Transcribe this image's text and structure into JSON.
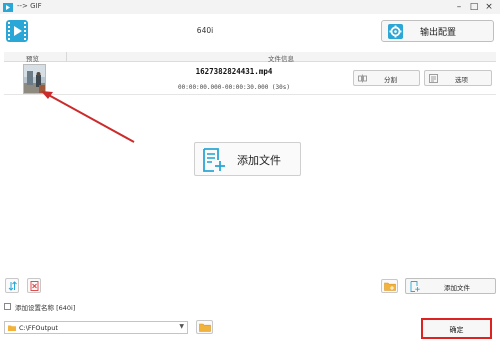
{
  "window": {
    "title": "--> GIF",
    "controls": [
      "minimize",
      "maximize",
      "close"
    ]
  },
  "toolbar": {
    "preset_name": "640i",
    "output_config_label": "输出配置"
  },
  "table": {
    "columns": [
      "预览",
      "文件信息"
    ],
    "rows": [
      {
        "filename": "1627382824431.mp4",
        "time_range": "00:00:00.000-00:00:30.000 (30s)",
        "split_label": "分割",
        "options_label": "选项"
      }
    ]
  },
  "empty_area": {
    "add_file_label": "添加文件"
  },
  "bottom": {
    "add_file_label": "添加文件",
    "add_preset_name_label": "添加设置名称 [640i]",
    "add_preset_name_checked": false,
    "output_path": "C:\\FFOutput",
    "ok_label": "确定"
  },
  "colors": {
    "accent": "#2aa7d6",
    "highlight": "#dd2222",
    "arrow": "#cc2b2b"
  },
  "icons": [
    "app-icon",
    "film-logo-icon",
    "gear-icon",
    "split-icon",
    "options-icon",
    "add-file-icon",
    "sort-icon",
    "delete-icon",
    "add-folder-icon",
    "folder-icon",
    "chevron-down-icon"
  ]
}
